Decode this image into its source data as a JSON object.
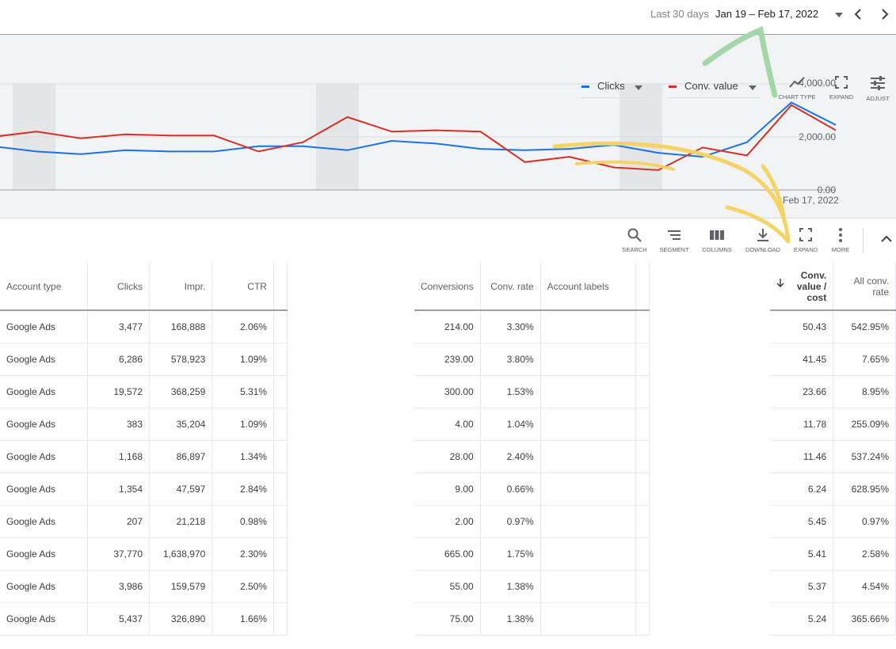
{
  "header": {
    "range_label": "Last 30 days",
    "range_value": "Jan 19 – Feb 17, 2022"
  },
  "chart_controls": {
    "metric1": {
      "label": "Clicks",
      "color": "#1a73e8"
    },
    "metric2": {
      "label": "Conv. value",
      "color": "#d93025"
    },
    "tools": [
      "CHART TYPE",
      "EXPAND",
      "ADJUST"
    ]
  },
  "chart_data": {
    "type": "line",
    "yticks": [
      "4,000.00",
      "2,000.00",
      "0.00"
    ],
    "ylim": [
      0,
      4000
    ],
    "xlabel_last": "Feb 17, 2022",
    "series": [
      {
        "name": "Clicks",
        "color": "#1a73e8",
        "values": [
          1650,
          1450,
          1350,
          1500,
          1450,
          1450,
          1650,
          1650,
          1500,
          1850,
          1750,
          1550,
          1500,
          1550,
          1700,
          1400,
          1250,
          1800,
          3300,
          2450
        ]
      },
      {
        "name": "Conv. value",
        "color": "#d93025",
        "values": [
          2000,
          2200,
          1950,
          2100,
          2050,
          2050,
          1450,
          1800,
          2750,
          2200,
          2250,
          2200,
          1050,
          1250,
          850,
          750,
          1600,
          1300,
          3200,
          2250
        ]
      }
    ]
  },
  "table_toolbar": [
    "SEARCH",
    "SEGMENT",
    "COLUMNS",
    "DOWNLOAD",
    "EXPAND",
    "MORE"
  ],
  "table_a": {
    "headers": [
      "Account type",
      "Clicks",
      "Impr.",
      "CTR"
    ],
    "rows": [
      [
        "Google Ads",
        "3,477",
        "168,888",
        "2.06%"
      ],
      [
        "Google Ads",
        "6,286",
        "578,923",
        "1.09%"
      ],
      [
        "Google Ads",
        "19,572",
        "368,259",
        "5.31%"
      ],
      [
        "Google Ads",
        "383",
        "35,204",
        "1.09%"
      ],
      [
        "Google Ads",
        "1,168",
        "86,897",
        "1.34%"
      ],
      [
        "Google Ads",
        "1,354",
        "47,597",
        "2.84%"
      ],
      [
        "Google Ads",
        "207",
        "21,218",
        "0.98%"
      ],
      [
        "Google Ads",
        "37,770",
        "1,638,970",
        "2.30%"
      ],
      [
        "Google Ads",
        "3,986",
        "159,579",
        "2.50%"
      ],
      [
        "Google Ads",
        "5,437",
        "326,890",
        "1.66%"
      ]
    ]
  },
  "table_b": {
    "headers": [
      "Conversions",
      "Conv. rate",
      "Account labels"
    ],
    "rows": [
      [
        "214.00",
        "3.30%",
        ""
      ],
      [
        "239.00",
        "3.80%",
        ""
      ],
      [
        "300.00",
        "1.53%",
        ""
      ],
      [
        "4.00",
        "1.04%",
        ""
      ],
      [
        "28.00",
        "2.40%",
        ""
      ],
      [
        "9.00",
        "0.66%",
        ""
      ],
      [
        "2.00",
        "0.97%",
        ""
      ],
      [
        "665.00",
        "1.75%",
        ""
      ],
      [
        "55.00",
        "1.38%",
        ""
      ],
      [
        "75.00",
        "1.38%",
        ""
      ]
    ]
  },
  "table_c": {
    "headers": [
      "Conv. value / cost",
      "All conv. rate"
    ],
    "rows": [
      [
        "50.43",
        "542.95%"
      ],
      [
        "41.45",
        "7.65%"
      ],
      [
        "23.66",
        "8.95%"
      ],
      [
        "11.78",
        "255.09%"
      ],
      [
        "11.46",
        "537.24%"
      ],
      [
        "6.24",
        "628.95%"
      ],
      [
        "5.45",
        "0.97%"
      ],
      [
        "5.41",
        "2.58%"
      ],
      [
        "5.37",
        "4.54%"
      ],
      [
        "5.24",
        "365.66%"
      ]
    ]
  }
}
